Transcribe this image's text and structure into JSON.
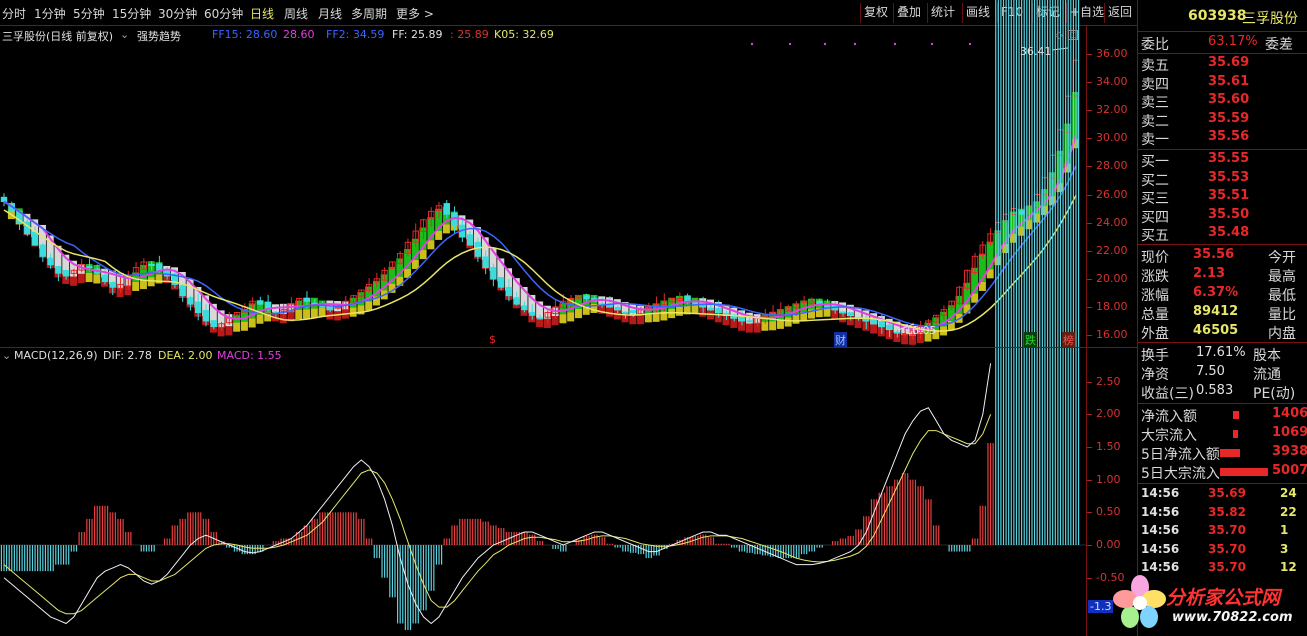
{
  "toolbar": {
    "periods": [
      "分时",
      "1分钟",
      "5分钟",
      "15分钟",
      "30分钟",
      "60分钟",
      "日线",
      "周线",
      "月线",
      "多周期",
      "更多"
    ],
    "active_period": "日线",
    "buttons": [
      "复权",
      "叠加",
      "统计",
      "画线",
      "F10",
      "标记",
      "+自选",
      "返回"
    ]
  },
  "main_chart": {
    "title": "三孚股份(日线 前复权)",
    "indicator_name": "强势趋势",
    "indicators": [
      {
        "label": "FF15: 28.60",
        "color": "#3c64ff"
      },
      {
        "label": "28.60",
        "color": "#e040e0"
      },
      {
        "label": "FF2: 34.59",
        "color": "#3c64ff"
      },
      {
        "label": "FF: 25.89",
        "color": "#e0e0e0"
      },
      {
        "label": ": 25.89",
        "color": "#d83232"
      },
      {
        "label": "K05: 32.69",
        "color": "#e6e66a"
      }
    ],
    "high_label": "36.41",
    "low_label": "16.05",
    "markers": [
      {
        "label": "$",
        "color": "#e82828"
      },
      {
        "label": "财",
        "color": "#3c78ff"
      },
      {
        "label": "跌",
        "color": "#28d828"
      },
      {
        "label": "榜",
        "color": "#e82828"
      }
    ],
    "price_axis": [
      "36.00",
      "34.00",
      "32.00",
      "30.00",
      "28.00",
      "26.00",
      "24.00",
      "22.00",
      "20.00",
      "18.00",
      "16.00"
    ]
  },
  "macd": {
    "title": "MACD(12,26,9)",
    "dif": "DIF: 2.78",
    "dea": "DEA: 2.00",
    "macd": "MACD: 1.55",
    "axis": [
      "2.50",
      "2.00",
      "1.50",
      "1.00",
      "0.50",
      "0.00",
      "-0.50"
    ],
    "axis_cut_label": "-1.3"
  },
  "quote": {
    "code": "603938",
    "name": "三孚股份",
    "weibi_label": "委比",
    "weibi_value": "63.17%",
    "weicha_label": "委差",
    "sell": [
      {
        "label": "卖五",
        "price": "35.69"
      },
      {
        "label": "卖四",
        "price": "35.61"
      },
      {
        "label": "卖三",
        "price": "35.60"
      },
      {
        "label": "卖二",
        "price": "35.59"
      },
      {
        "label": "卖一",
        "price": "35.56"
      }
    ],
    "buy": [
      {
        "label": "买一",
        "price": "35.55"
      },
      {
        "label": "买二",
        "price": "35.53"
      },
      {
        "label": "买三",
        "price": "35.51"
      },
      {
        "label": "买四",
        "price": "35.50"
      },
      {
        "label": "买五",
        "price": "35.48"
      }
    ],
    "stats": [
      {
        "label": "现价",
        "value": "35.56",
        "label2": "今开"
      },
      {
        "label": "涨跌",
        "value": "2.13",
        "label2": "最高"
      },
      {
        "label": "涨幅",
        "value": "6.37%",
        "label2": "最低"
      },
      {
        "label": "总量",
        "value": "89412",
        "label2": "量比"
      },
      {
        "label": "外盘",
        "value": "46505",
        "label2": "内盘"
      }
    ],
    "stats2": [
      {
        "label": "换手",
        "value": "17.61%",
        "label2": "股本"
      },
      {
        "label": "净资",
        "value": "7.50",
        "label2": "流通"
      },
      {
        "label": "收益(三)",
        "value": "0.583",
        "label2": "PE(动)"
      }
    ],
    "flows": [
      {
        "label": "净流入额",
        "value": "1406"
      },
      {
        "label": "大宗流入",
        "value": "1069"
      },
      {
        "label": "5日净流入额",
        "value": "3938"
      },
      {
        "label": "5日大宗流入",
        "value": "5007"
      }
    ],
    "ticks": [
      {
        "time": "14:56",
        "price": "35.69",
        "vol": "24"
      },
      {
        "time": "14:56",
        "price": "35.82",
        "vol": "22"
      },
      {
        "time": "14:56",
        "price": "35.70",
        "vol": "1"
      },
      {
        "time": "14:56",
        "price": "35.70",
        "vol": "3"
      },
      {
        "time": "14:56",
        "price": "35.70",
        "vol": "12"
      }
    ]
  },
  "watermark": {
    "title": "分析家公式网",
    "url": "www.70822.com"
  },
  "colors": {
    "up": "#e82828",
    "down": "#3cdcdc",
    "accent": "#e6e66a",
    "border": "#7a1212"
  },
  "chart_data": [
    {
      "type": "candlestick",
      "title": "三孚股份(日线 前复权)",
      "ylim": [
        15.5,
        37
      ],
      "y_ticks": [
        16,
        18,
        20,
        22,
        24,
        26,
        28,
        30,
        32,
        34,
        36
      ],
      "series": [
        {
          "values": [
            25.5,
            24.8,
            24.0,
            23.2,
            22.4,
            21.6,
            21.0,
            20.4,
            20.2,
            20.6,
            21.0,
            20.8,
            20.4,
            19.8,
            19.4,
            19.6,
            20.2,
            20.8,
            21.2,
            21.0,
            20.6,
            20.2,
            19.6,
            18.8,
            18.2,
            17.6,
            17.0,
            16.6,
            16.8,
            17.2,
            17.6,
            18.0,
            18.4,
            18.2,
            17.8,
            17.6,
            17.8,
            18.2,
            18.6,
            18.4,
            18.2,
            18.0,
            17.8,
            18.0,
            18.4,
            18.8,
            19.2,
            19.6,
            20.0,
            20.6,
            21.2,
            21.8,
            22.6,
            23.4,
            24.2,
            24.8,
            25.2,
            24.6,
            23.8,
            23.0,
            22.4,
            21.6,
            20.8,
            20.0,
            19.4,
            18.8,
            18.2,
            17.8,
            17.4,
            17.2,
            17.6,
            18.0,
            18.4,
            18.6,
            18.8,
            18.6,
            18.4,
            18.2,
            18.0,
            17.8,
            17.6,
            17.6,
            17.8,
            18.0,
            18.2,
            18.4,
            18.6,
            18.6,
            18.4,
            18.2,
            18.0,
            17.8,
            17.6,
            17.4,
            17.2,
            17.0,
            17.0,
            17.2,
            17.4,
            17.6,
            17.8,
            18.0,
            18.2,
            18.4,
            18.4,
            18.2,
            18.0,
            17.8,
            17.6,
            17.4,
            17.2,
            17.0,
            16.8,
            16.6,
            16.4,
            16.2,
            16.1,
            16.3,
            16.6,
            17.0,
            17.4,
            17.8,
            18.4,
            19.4,
            20.6,
            21.6,
            22.4,
            23.2,
            24.0,
            24.6,
            25.0,
            24.6,
            25.2,
            26.0,
            27.2,
            28.8,
            30.6,
            33.0,
            35.56
          ]
        }
      ]
    },
    {
      "type": "bar",
      "title": "MACD(12,26,9)",
      "ylim": [
        -1.3,
        2.8
      ],
      "y_ticks": [
        -0.5,
        0,
        0.5,
        1.0,
        1.5,
        2.0,
        2.5
      ],
      "series": [
        {
          "name": "DIF: 2.78",
          "values": [
            -0.5,
            -0.6,
            -0.7,
            -0.8,
            -0.9,
            -1.0,
            -1.1,
            -1.15,
            -1.2,
            -1.1,
            -0.9,
            -0.7,
            -0.5,
            -0.4,
            -0.35,
            -0.3,
            -0.35,
            -0.45,
            -0.55,
            -0.6,
            -0.55,
            -0.45,
            -0.3,
            -0.15,
            0.0,
            0.1,
            0.15,
            0.1,
            0.05,
            0.0,
            -0.05,
            -0.1,
            -0.12,
            -0.1,
            -0.05,
            0.0,
            0.05,
            0.1,
            0.2,
            0.3,
            0.45,
            0.6,
            0.75,
            0.9,
            1.05,
            1.2,
            1.3,
            1.2,
            1.0,
            0.7,
            0.3,
            -0.2,
            -0.6,
            -0.9,
            -1.1,
            -1.2,
            -1.1,
            -0.9,
            -0.7,
            -0.5,
            -0.35,
            -0.2,
            -0.1,
            0.0,
            0.05,
            0.1,
            0.15,
            0.2,
            0.2,
            0.15,
            0.1,
            0.05,
            0.0,
            0.05,
            0.1,
            0.15,
            0.2,
            0.2,
            0.15,
            0.1,
            0.05,
            0.0,
            -0.05,
            -0.1,
            -0.1,
            -0.05,
            0.0,
            0.05,
            0.1,
            0.15,
            0.2,
            0.2,
            0.15,
            0.15,
            0.1,
            0.05,
            0.0,
            -0.05,
            -0.1,
            -0.15,
            -0.2,
            -0.25,
            -0.3,
            -0.3,
            -0.3,
            -0.28,
            -0.25,
            -0.2,
            -0.15,
            -0.1,
            0.0,
            0.2,
            0.5,
            0.8,
            1.1,
            1.4,
            1.7,
            1.9,
            2.05,
            2.1,
            1.9,
            1.7,
            1.6,
            1.55,
            1.5,
            1.6,
            2.0,
            2.78
          ]
        },
        {
          "name": "DEA: 2.00",
          "values": [
            -0.3,
            -0.4,
            -0.5,
            -0.6,
            -0.7,
            -0.8,
            -0.9,
            -1.0,
            -1.05,
            -1.05,
            -1.0,
            -0.9,
            -0.8,
            -0.7,
            -0.6,
            -0.5,
            -0.45,
            -0.45,
            -0.5,
            -0.55,
            -0.55,
            -0.5,
            -0.45,
            -0.35,
            -0.25,
            -0.15,
            -0.05,
            0.0,
            0.02,
            0.02,
            0.0,
            -0.03,
            -0.05,
            -0.05,
            -0.05,
            -0.03,
            0.0,
            0.05,
            0.1,
            0.15,
            0.25,
            0.35,
            0.5,
            0.65,
            0.8,
            0.95,
            1.1,
            1.15,
            1.1,
            0.95,
            0.7,
            0.4,
            0.05,
            -0.3,
            -0.6,
            -0.85,
            -0.95,
            -0.95,
            -0.85,
            -0.7,
            -0.55,
            -0.4,
            -0.28,
            -0.15,
            -0.08,
            0.0,
            0.05,
            0.1,
            0.12,
            0.12,
            0.1,
            0.08,
            0.05,
            0.05,
            0.06,
            0.08,
            0.12,
            0.14,
            0.14,
            0.12,
            0.1,
            0.06,
            0.02,
            0.0,
            -0.02,
            -0.02,
            -0.01,
            0.01,
            0.04,
            0.08,
            0.12,
            0.14,
            0.14,
            0.14,
            0.12,
            0.1,
            0.06,
            0.02,
            -0.02,
            -0.06,
            -0.1,
            -0.15,
            -0.2,
            -0.23,
            -0.25,
            -0.26,
            -0.25,
            -0.23,
            -0.2,
            -0.17,
            -0.12,
            -0.02,
            0.15,
            0.4,
            0.65,
            0.9,
            1.15,
            1.4,
            1.6,
            1.75,
            1.75,
            1.7,
            1.65,
            1.6,
            1.55,
            1.55,
            1.7,
            2.0
          ]
        }
      ]
    }
  ]
}
